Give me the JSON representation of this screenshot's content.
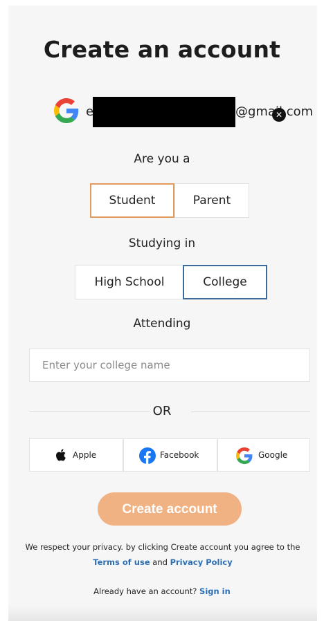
{
  "title": "Create an account",
  "account": {
    "email_prefix": "e",
    "email_domain": "@gmail.com",
    "remove_icon": "close-circle-icon"
  },
  "role": {
    "question": "Are you a",
    "options": [
      "Student",
      "Parent"
    ],
    "selected": "Student"
  },
  "study": {
    "question": "Studying in",
    "options": [
      "High School",
      "College"
    ],
    "selected": "College"
  },
  "attending": {
    "label": "Attending",
    "placeholder": "Enter your college name",
    "value": ""
  },
  "divider_text": "OR",
  "social": {
    "apple": "Apple",
    "facebook": "Facebook",
    "google": "Google"
  },
  "create_button": "Create account",
  "privacy": {
    "text_before": "We respect your privacy. by clicking Create account you agree to the",
    "terms_link": "Terms of use",
    "and": "and",
    "privacy_link": "Privacy Policy"
  },
  "signin": {
    "prompt": "Already have an account?",
    "link": "Sign in"
  },
  "colors": {
    "accent_orange": "#e29b5f",
    "button_orange": "#f0b282",
    "selected_blue": "#3d6b99",
    "link_blue": "#2c6fb5",
    "facebook_blue": "#1877f2"
  }
}
